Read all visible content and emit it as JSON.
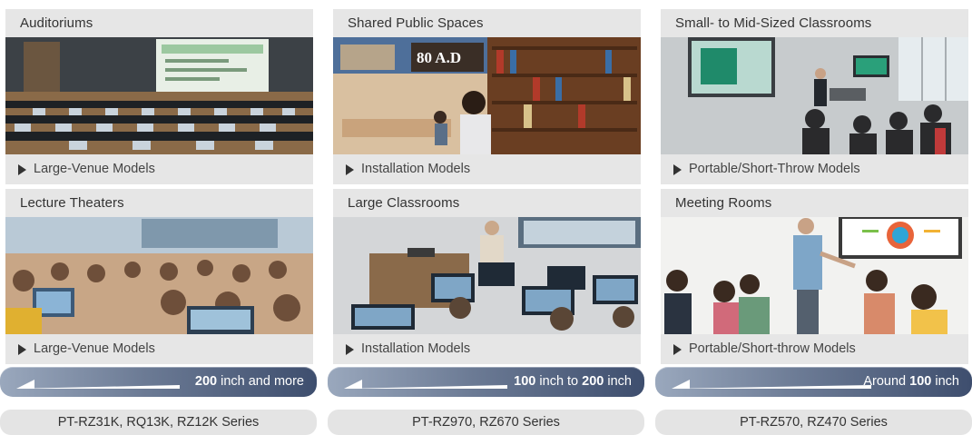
{
  "columns": [
    {
      "size_range": {
        "prefix": "",
        "num1": "200",
        "middle": " inch and more",
        "num2": "",
        "suffix": ""
      },
      "series": "PT-RZ31K, RQ13K, RZ12K Series",
      "cards": [
        {
          "title": "Auditoriums",
          "link": "Large-Venue Models",
          "photo": "auditorium-photo"
        },
        {
          "title": "Lecture Theaters",
          "link": "Large-Venue Models",
          "photo": "lecture-theater-photo"
        }
      ]
    },
    {
      "size_range": {
        "prefix": "",
        "num1": "100",
        "middle": " inch to ",
        "num2": "200",
        "suffix": " inch"
      },
      "series": "PT-RZ970, RZ670 Series",
      "cards": [
        {
          "title": "Shared Public Spaces",
          "link": "Installation Models",
          "photo": "public-space-photo",
          "screen_text": "80 A.D"
        },
        {
          "title": "Large Classrooms",
          "link": "Installation Models",
          "photo": "large-classroom-photo"
        }
      ]
    },
    {
      "size_range": {
        "prefix": "Around ",
        "num1": "100",
        "middle": " inch",
        "num2": "",
        "suffix": ""
      },
      "series": "PT-RZ570, RZ470 Series",
      "cards": [
        {
          "title": "Small- to Mid-Sized Classrooms",
          "link": "Portable/Short-Throw Models",
          "photo": "small-classroom-photo"
        },
        {
          "title": "Meeting Rooms",
          "link": "Portable/Short-throw Models",
          "photo": "meeting-room-photo"
        }
      ]
    }
  ]
}
